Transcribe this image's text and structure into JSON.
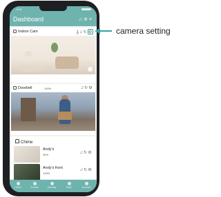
{
  "app": {
    "title": "Dashboard",
    "status_time": "9:41"
  },
  "header_icons": [
    "bell-icon",
    "plus-icon",
    "menu-icon"
  ],
  "cameras": [
    {
      "name": "Indoor Cam",
      "battery": ""
    },
    {
      "name": "Doorbell",
      "battery": "100%"
    }
  ],
  "chime": {
    "title": "Chime",
    "devices": [
      {
        "name": "Andy's",
        "battery": "40%"
      },
      {
        "name": "Andy's front",
        "battery": "100%"
      }
    ]
  },
  "tabs": [
    "Home",
    "Events",
    "Security",
    "More",
    "Account"
  ],
  "callout": {
    "label": "camera setting"
  },
  "colors": {
    "accent": "#6fb3ae",
    "callout": "#3aa0a0",
    "phone": "#1e1f22"
  }
}
